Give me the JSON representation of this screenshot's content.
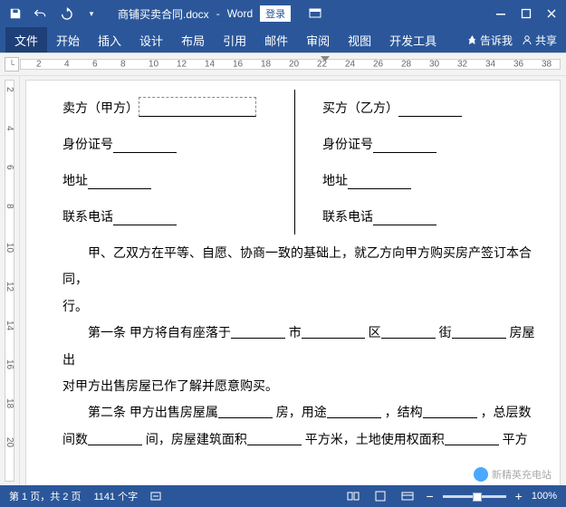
{
  "title": {
    "filename": "商铺买卖合同.docx",
    "sep": " - ",
    "app": "Word",
    "login": "登录"
  },
  "ribbon": {
    "file": "文件",
    "tabs": [
      "开始",
      "插入",
      "设计",
      "布局",
      "引用",
      "邮件",
      "审阅",
      "视图",
      "开发工具"
    ],
    "tellme": "告诉我",
    "share": "共享"
  },
  "ruler": {
    "ticks": [
      "2",
      "4",
      "6",
      "8",
      "10",
      "12",
      "14",
      "16",
      "18",
      "20",
      "22",
      "24",
      "26",
      "28",
      "30",
      "32",
      "34",
      "36",
      "38"
    ]
  },
  "vruler": {
    "ticks": [
      "2",
      "4",
      "6",
      "8",
      "10",
      "12",
      "14",
      "16",
      "18",
      "20"
    ]
  },
  "doc": {
    "left": {
      "seller": "卖方（甲方）",
      "id": "身份证号",
      "addr": "地址",
      "phone": "联系电话"
    },
    "right": {
      "buyer": "买方（乙方）",
      "id": "身份证号",
      "addr": "地址",
      "phone": "联系电话"
    },
    "para1": "甲、乙双方在平等、自愿、协商一致的基础上，就乙方向甲方购买房产签订本合同，",
    "para1b": "行。",
    "art1_a": "第一条  甲方将自有座落于",
    "art1_b": "市",
    "art1_c": "区",
    "art1_d": "街",
    "art1_e": "房屋出",
    "art1_line2": "对甲方出售房屋已作了解并愿意购买。",
    "art2_a": "第二条  甲方出售房屋属",
    "art2_b": "房，用途",
    "art2_c": "，结构",
    "art2_d": "，总层数",
    "art2_line2a": "间数",
    "art2_line2b": "间，房屋建筑面积",
    "art2_line2c": "平方米，土地使用权面积",
    "art2_line2d": "平方"
  },
  "status": {
    "page": "第 1 页，共 2 页",
    "words": "1141 个字",
    "zoom": "100%"
  },
  "watermark": "新精英充电站"
}
